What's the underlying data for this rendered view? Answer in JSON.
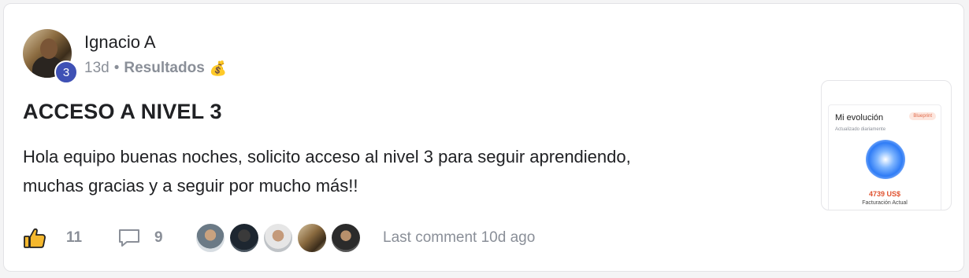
{
  "post": {
    "author": "Ignacio A",
    "level": "3",
    "time_ago": "13d",
    "separator": "•",
    "category": "Resultados",
    "category_emoji": "💰",
    "title": "ACCESO A NIVEL 3",
    "body_line1": "Hola equipo buenas noches, solicito acceso al nivel 3 para seguir aprendiendo,",
    "body_line2": "muchas gracias y a seguir por mucho más!!"
  },
  "attachment": {
    "title": "Mi evolución",
    "badge": "Blueprint",
    "subtitle": "Actualizado diariamente",
    "amount": "4739 US$",
    "label": "Facturación Actual"
  },
  "actions": {
    "likes": "11",
    "comments": "9",
    "last_comment": "Last comment 10d ago"
  },
  "colors": {
    "badge_bg": "#3f51b5",
    "muted": "#8a8f98",
    "accent_amount": "#e0522f"
  }
}
